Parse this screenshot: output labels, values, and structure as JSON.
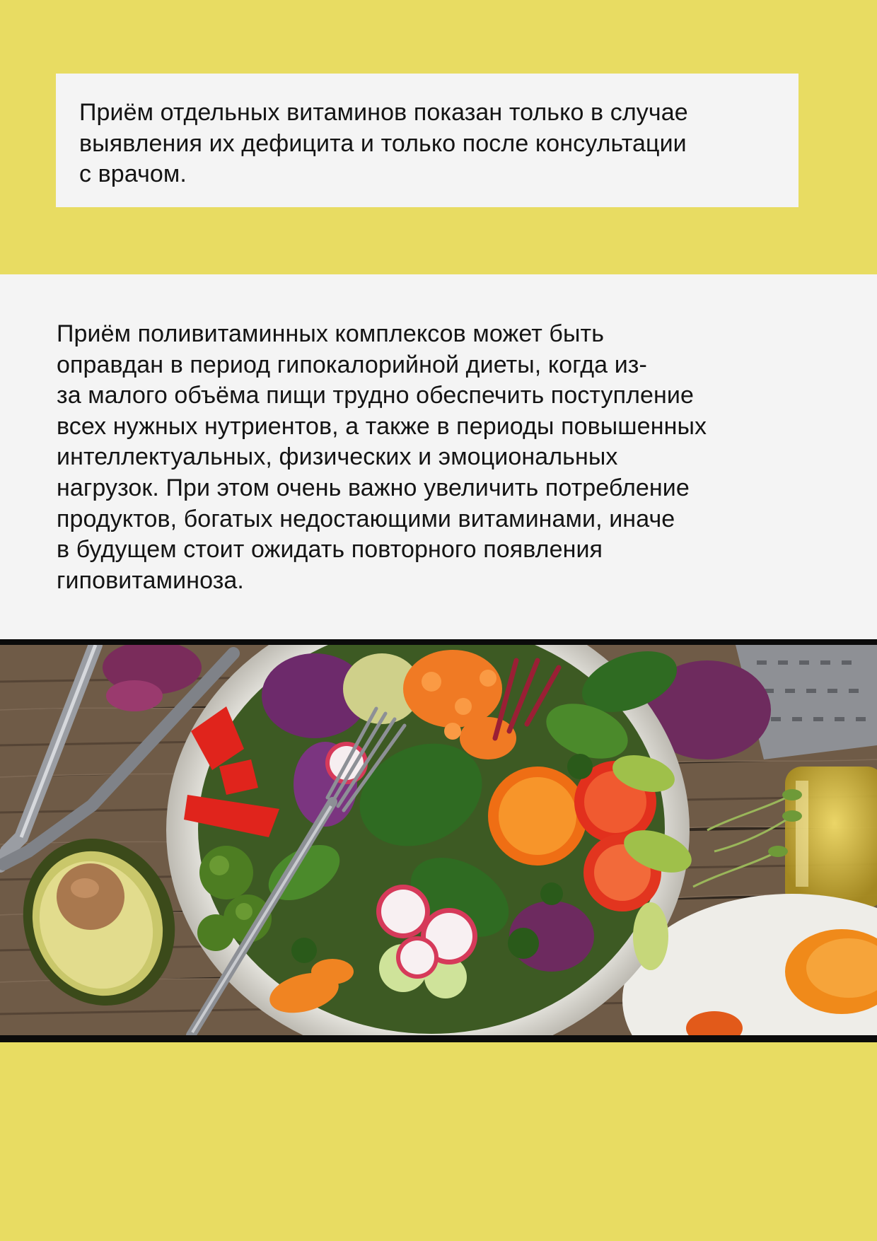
{
  "note": {
    "lines": [
      "Приём отдельных витаминов показан только в случае",
      "выявления их дефицита и только после консультации",
      "с врачом."
    ]
  },
  "body": {
    "lines": [
      "Приём поливитаминных комплексов может быть",
      "оправдан в период гипокалорийной диеты, когда из-",
      "за малого объёма пищи трудно обеспечить поступление",
      "всех нужных нутриентов, а также в периоды повышенных",
      "интеллектуальных, физических и эмоциональных",
      "нагрузок. При этом очень важно увеличить потребление",
      "продуктов, богатых недостающими витаминами, иначе",
      "в будущем стоит ожидать повторного появления",
      "гиповитаминоза."
    ]
  },
  "colors": {
    "background": "#e8dc62",
    "panel": "#f4f4f4",
    "text": "#141414"
  }
}
